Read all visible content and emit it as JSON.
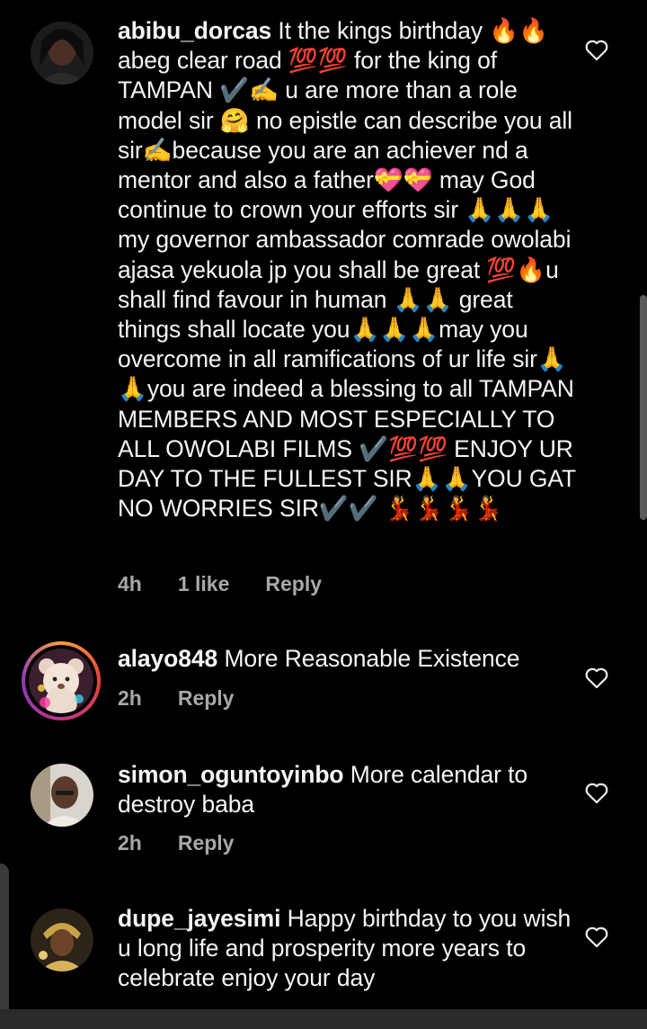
{
  "comments": [
    {
      "username": "abibu_dorcas",
      "text": " It the kings birthday 🔥🔥 abeg clear road 💯💯 for the king of TAMPAN ✔️✍️ u are more than a role model sir 🤗 no epistle can describe you all sir✍️because you are an achiever nd a mentor and also a father💝💝 may God continue to crown your efforts sir 🙏🙏🙏 my governor ambassador comrade owolabi ajasa yekuola jp you shall be great 💯🔥u shall find favour in human 🙏🙏 great things shall locate you🙏🙏🙏may you overcome in all ramifications of ur life sir🙏🙏you are indeed a blessing to all TAMPAN MEMBERS AND MOST ESPECIALLY TO ALL OWOLABI FILMS ✔️💯💯 ENJOY UR DAY TO THE FULLEST SIR🙏🙏YOU GAT NO WORRIES SIR✔️✔️ 💃💃💃💃",
      "time": "4h",
      "likes": "1 like",
      "reply": "Reply"
    },
    {
      "username": "alayo848",
      "text": " More Reasonable Existence",
      "time": "2h",
      "reply": "Reply"
    },
    {
      "username": "simon_oguntoyinbo",
      "text": " More calendar to destroy baba",
      "time": "2h",
      "reply": "Reply"
    },
    {
      "username": "dupe_jayesimi",
      "text": " Happy birthday to you wish u long life and prosperity more years to celebrate enjoy your day"
    }
  ],
  "icons": {
    "heart": "heart-outline-icon"
  },
  "colors": {
    "background": "#000000",
    "text": "#f5f5f5",
    "meta": "#a8a8a8",
    "story_ring": "#e8403a"
  }
}
